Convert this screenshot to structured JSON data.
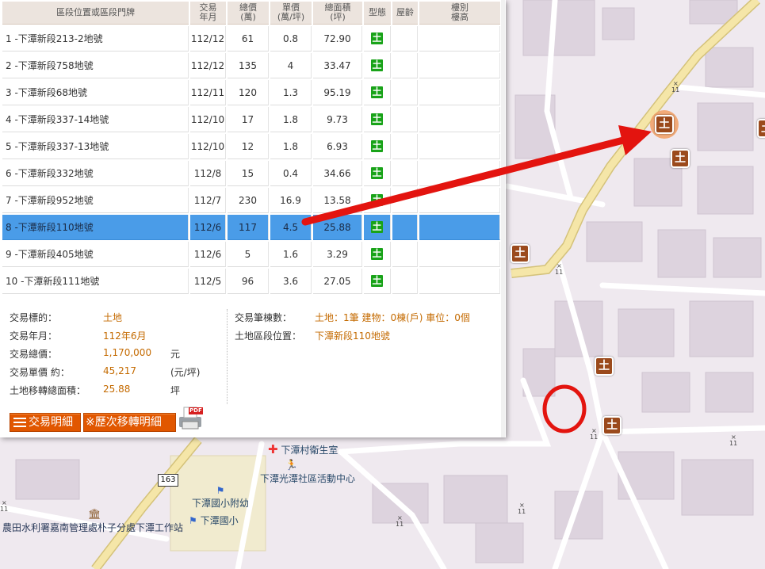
{
  "table": {
    "headers": {
      "address": "區段位置或區段門牌",
      "date": "交易\n年月",
      "total": "總價\n(萬)",
      "unit": "單價\n(萬/坪)",
      "area": "總面積\n(坪)",
      "type": "型態",
      "age": "屋齡",
      "floor": "樓別\n樓高"
    },
    "type_glyph": "土",
    "rows": [
      {
        "address": "1 -下潭新段213-2地號",
        "date": "112/12",
        "total": "61",
        "unit": "0.8",
        "area": "72.90"
      },
      {
        "address": "2 -下潭新段758地號",
        "date": "112/12",
        "total": "135",
        "unit": "4",
        "area": "33.47"
      },
      {
        "address": "3 -下潭新段68地號",
        "date": "112/11",
        "total": "120",
        "unit": "1.3",
        "area": "95.19"
      },
      {
        "address": "4 -下潭新段337-14地號",
        "date": "112/10",
        "total": "17",
        "unit": "1.8",
        "area": "9.73"
      },
      {
        "address": "5 -下潭新段337-13地號",
        "date": "112/10",
        "total": "12",
        "unit": "1.8",
        "area": "6.93"
      },
      {
        "address": "6 -下潭新段332地號",
        "date": "112/8",
        "total": "15",
        "unit": "0.4",
        "area": "34.66"
      },
      {
        "address": "7 -下潭新段952地號",
        "date": "112/7",
        "total": "230",
        "unit": "16.9",
        "area": "13.58"
      },
      {
        "address": "8 -下潭新段110地號",
        "date": "112/6",
        "total": "117",
        "unit": "4.5",
        "area": "25.88"
      },
      {
        "address": "9 -下潭新段405地號",
        "date": "112/6",
        "total": "5",
        "unit": "1.6",
        "area": "3.29"
      },
      {
        "address": "10 -下潭新段111地號",
        "date": "112/5",
        "total": "96",
        "unit": "3.6",
        "area": "27.05"
      }
    ],
    "selected_row": 8
  },
  "detail": {
    "target_label": "交易標的：",
    "target": "土地",
    "date_label": "交易年月：",
    "date": "112年6月",
    "total_label": "交易總價：",
    "total": "1,170,000",
    "total_unit": "元",
    "unit_label": "交易單價 約：",
    "unit": "45,217",
    "unit_unit": "(元/坪)",
    "area_label": "土地移轉總面積：",
    "area": "25.88",
    "area_unit": "坪",
    "count_label": "交易筆棟數：",
    "count": "土地：1筆 建物：0棟(戶) 車位：0個",
    "location_label": "土地區段位置：",
    "location": "下潭新段110地號"
  },
  "buttons": {
    "detail": "交易明細",
    "history": "※歷次移轉明細",
    "pdf": "PDF"
  },
  "map": {
    "road_badge": "163",
    "clinic": "下潭村衛生室",
    "community_center": "下潭光潭社區活動中心",
    "kindergarten": "下潭國小附幼",
    "school": "下潭國小",
    "irrigation": "農田水利署嘉南管理處朴子分處下潭工作站",
    "pin_glyph": "土",
    "elevation_marker": "11",
    "colors": {
      "arrow": "#e3140f",
      "circle": "#e3140f",
      "road": "#f5e6a8",
      "pin": "#9b4a1c"
    }
  }
}
